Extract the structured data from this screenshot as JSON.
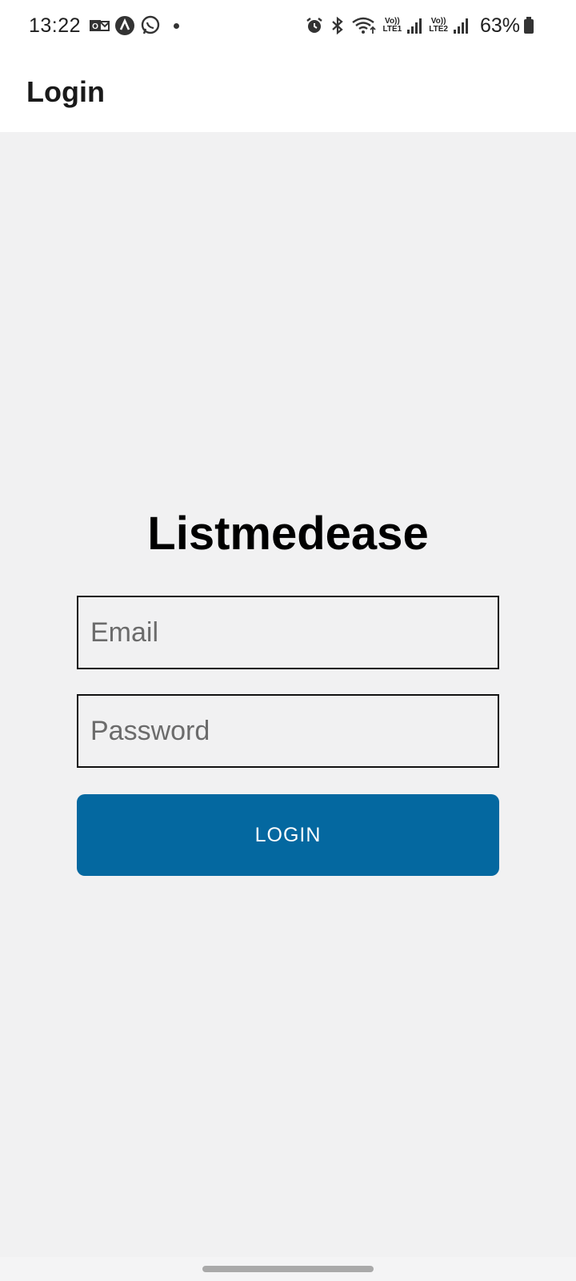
{
  "status_bar": {
    "time": "13:22",
    "battery_percent": "63%",
    "sim1_label_top": "Vo))",
    "sim1_label_bottom": "LTE1",
    "sim2_label_top": "Vo))",
    "sim2_label_bottom": "LTE2",
    "left_icons": [
      "outlook-icon",
      "app-a-icon",
      "whatsapp-icon",
      "notification-dot"
    ],
    "right_icons": [
      "alarm-icon",
      "bluetooth-icon",
      "wifi-icon",
      "signal-icon",
      "signal-icon",
      "battery-icon"
    ]
  },
  "app_bar": {
    "title": "Login"
  },
  "login": {
    "brand": "Listmedease",
    "email_placeholder": "Email",
    "email_value": "",
    "password_placeholder": "Password",
    "password_value": "",
    "button_label": "LOGIN"
  },
  "colors": {
    "primary": "#0468a0",
    "background": "#f1f1f2",
    "appbar": "#ffffff"
  }
}
